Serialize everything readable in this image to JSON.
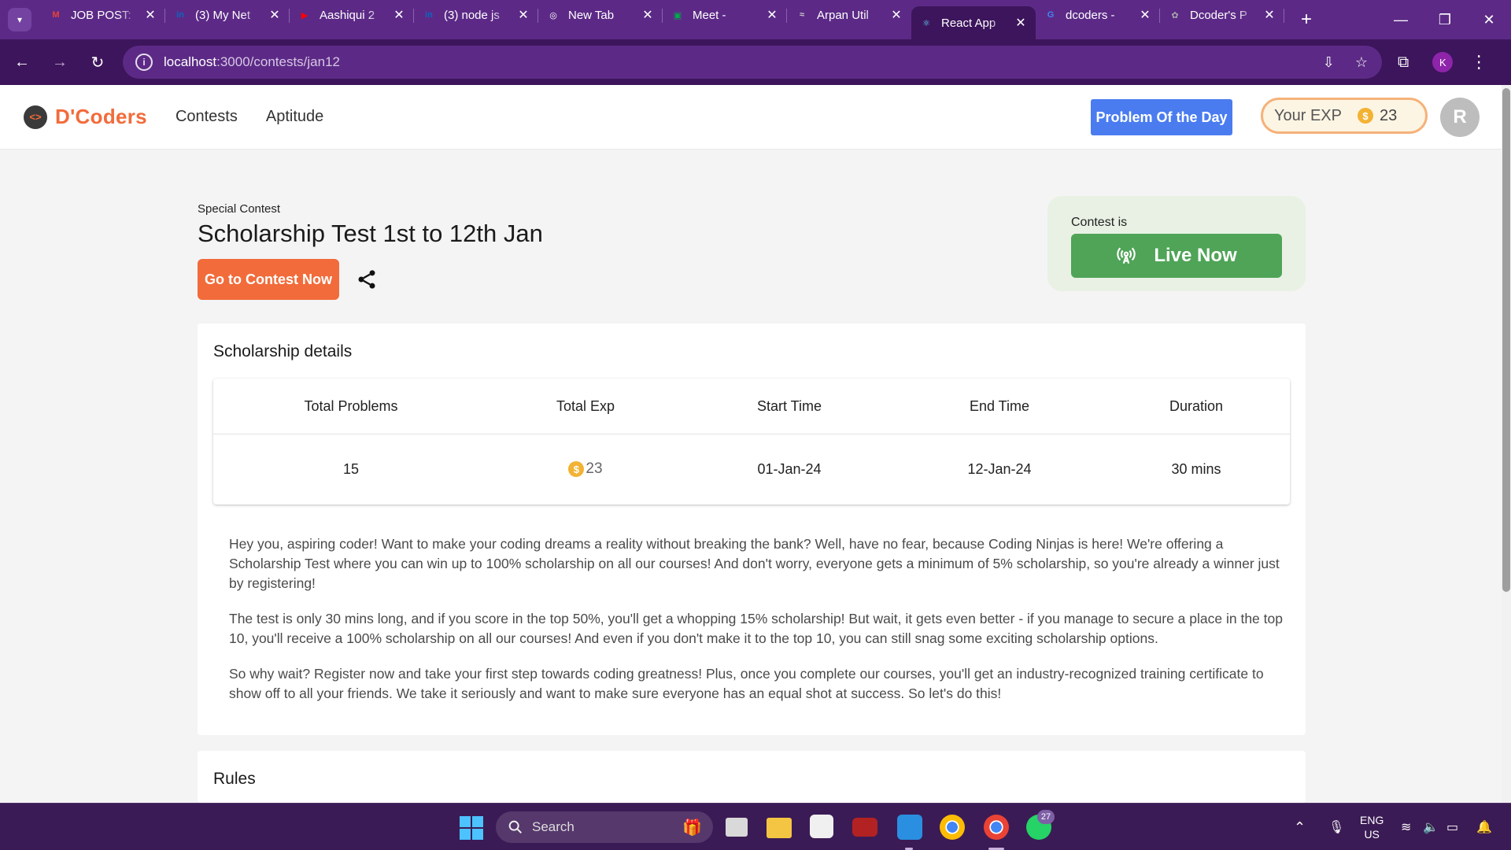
{
  "browser": {
    "tabs": [
      {
        "title": "JOB POST:",
        "favicon": "gmail-icon",
        "color": "#ea4335",
        "glyph": "M"
      },
      {
        "title": "(3) My Net",
        "favicon": "linkedin-icon",
        "color": "#0a66c2",
        "glyph": "in"
      },
      {
        "title": "Aashiqui 2",
        "favicon": "youtube-icon",
        "color": "#ff0000",
        "glyph": "▶"
      },
      {
        "title": "(3) node js",
        "favicon": "linkedin-icon",
        "color": "#0a66c2",
        "glyph": "in"
      },
      {
        "title": "New Tab",
        "favicon": "chrome-icon",
        "color": "#ffffff",
        "glyph": "◎"
      },
      {
        "title": "Meet -",
        "favicon": "meet-icon",
        "color": "#00ac47",
        "glyph": "▣"
      },
      {
        "title": "Arpan Util",
        "favicon": "site-icon",
        "color": "#cccccc",
        "glyph": "≈"
      },
      {
        "title": "React App",
        "favicon": "react-icon",
        "color": "#61dafb",
        "glyph": "⚛",
        "active": true
      },
      {
        "title": "dcoders -",
        "favicon": "google-icon",
        "color": "#4285f4",
        "glyph": "G"
      },
      {
        "title": "Dcoder's P",
        "favicon": "site-icon",
        "color": "#aaaaaa",
        "glyph": "✿"
      }
    ],
    "url_host": "localhost",
    "url_path": ":3000/contests/jan12",
    "profile_initial": "K"
  },
  "header": {
    "logo_text": "D'Coders",
    "logo_mark": "<>",
    "nav": [
      "Contests",
      "Aptitude"
    ],
    "potd_label": "Problem Of the Day",
    "exp_label": "Your EXP",
    "exp_value": "23",
    "avatar_initial": "R"
  },
  "contest": {
    "eyebrow": "Special Contest",
    "title": "Scholarship Test 1st to 12th Jan",
    "go_label": "Go to Contest Now",
    "status_label": "Contest is",
    "live_label": "Live Now"
  },
  "details": {
    "heading": "Scholarship details",
    "columns": [
      "Total Problems",
      "Total Exp",
      "Start Time",
      "End Time",
      "Duration"
    ],
    "values": {
      "problems": "15",
      "exp": "23",
      "start": "01-Jan-24",
      "end": "12-Jan-24",
      "duration": "30 mins"
    },
    "paragraphs": [
      "Hey you, aspiring coder! Want to make your coding dreams a reality without breaking the bank? Well, have no fear, because Coding Ninjas is here! We're offering a Scholarship Test where you can win up to 100% scholarship on all our courses! And don't worry, everyone gets a minimum of 5% scholarship, so you're already a winner just by registering!",
      "The test is only 30 mins long, and if you score in the top 50%, you'll get a whopping 15% scholarship! But wait, it gets even better - if you manage to secure a place in the top 10, you'll receive a 100% scholarship on all our courses! And even if you don't make it to the top 10, you can still snag some exciting scholarship options.",
      "So why wait? Register now and take your first step towards coding greatness! Plus, once you complete our courses, you'll get an industry-recognized training certificate to show off to all your friends. We take it seriously and want to make sure everyone has an equal shot at success. So let's do this!"
    ]
  },
  "rules": {
    "heading": "Rules"
  },
  "taskbar": {
    "search_label": "Search",
    "whatsapp_badge": "27",
    "lang_top": "ENG",
    "lang_bottom": "US"
  },
  "colors": {
    "brand": "#f26b3a",
    "potd": "#4a7cf0",
    "live": "#4fa457",
    "chrome": "#5c2a86"
  }
}
